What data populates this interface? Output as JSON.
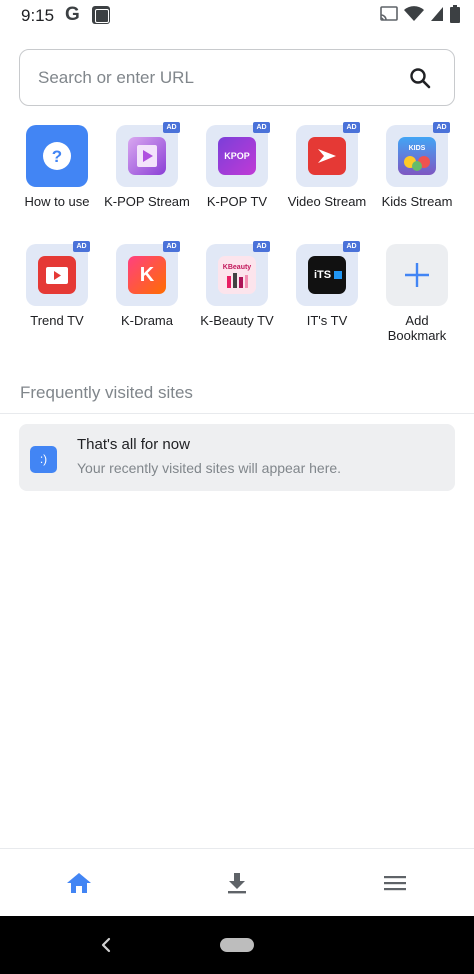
{
  "status_bar": {
    "time": "9:15",
    "g_letter": "G"
  },
  "search": {
    "placeholder": "Search or enter URL"
  },
  "shortcuts": [
    {
      "label": "How to use",
      "icon": "help-icon",
      "ad": false
    },
    {
      "label": "K-POP Stream",
      "icon": "kpop-stream-icon",
      "ad": true,
      "badge": "AD"
    },
    {
      "label": "K-POP TV",
      "icon": "kpop-tv-icon",
      "ad": true,
      "badge": "AD",
      "tile_text": "KPOP"
    },
    {
      "label": "Video Stream",
      "icon": "video-stream-icon",
      "ad": true,
      "badge": "AD"
    },
    {
      "label": "Kids Stream",
      "icon": "kids-stream-icon",
      "ad": true,
      "badge": "AD",
      "tile_text": "KIDS"
    },
    {
      "label": "Trend TV",
      "icon": "trend-tv-icon",
      "ad": true,
      "badge": "AD"
    },
    {
      "label": "K-Drama",
      "icon": "k-drama-icon",
      "ad": true,
      "badge": "AD",
      "tile_text": "K"
    },
    {
      "label": "K-Beauty TV",
      "icon": "k-beauty-tv-icon",
      "ad": true,
      "badge": "AD",
      "tile_text": "KBeauty"
    },
    {
      "label": "IT's TV",
      "icon": "its-tv-icon",
      "ad": true,
      "badge": "AD",
      "tile_text": "iTS"
    },
    {
      "label": "Add Bookmark",
      "icon": "plus-icon",
      "ad": false
    }
  ],
  "frequent": {
    "heading": "Frequently visited sites",
    "card_icon_text": ":)",
    "card_title": "That's all for now",
    "card_subtitle": "Your recently visited sites will appear here."
  },
  "bottom_nav": {
    "items": [
      "home-icon",
      "download-icon",
      "menu-icon"
    ]
  },
  "colors": {
    "accent": "#4285f4",
    "ad_badge": "#4a72d9",
    "tile_bg": "#e1e8f6"
  }
}
